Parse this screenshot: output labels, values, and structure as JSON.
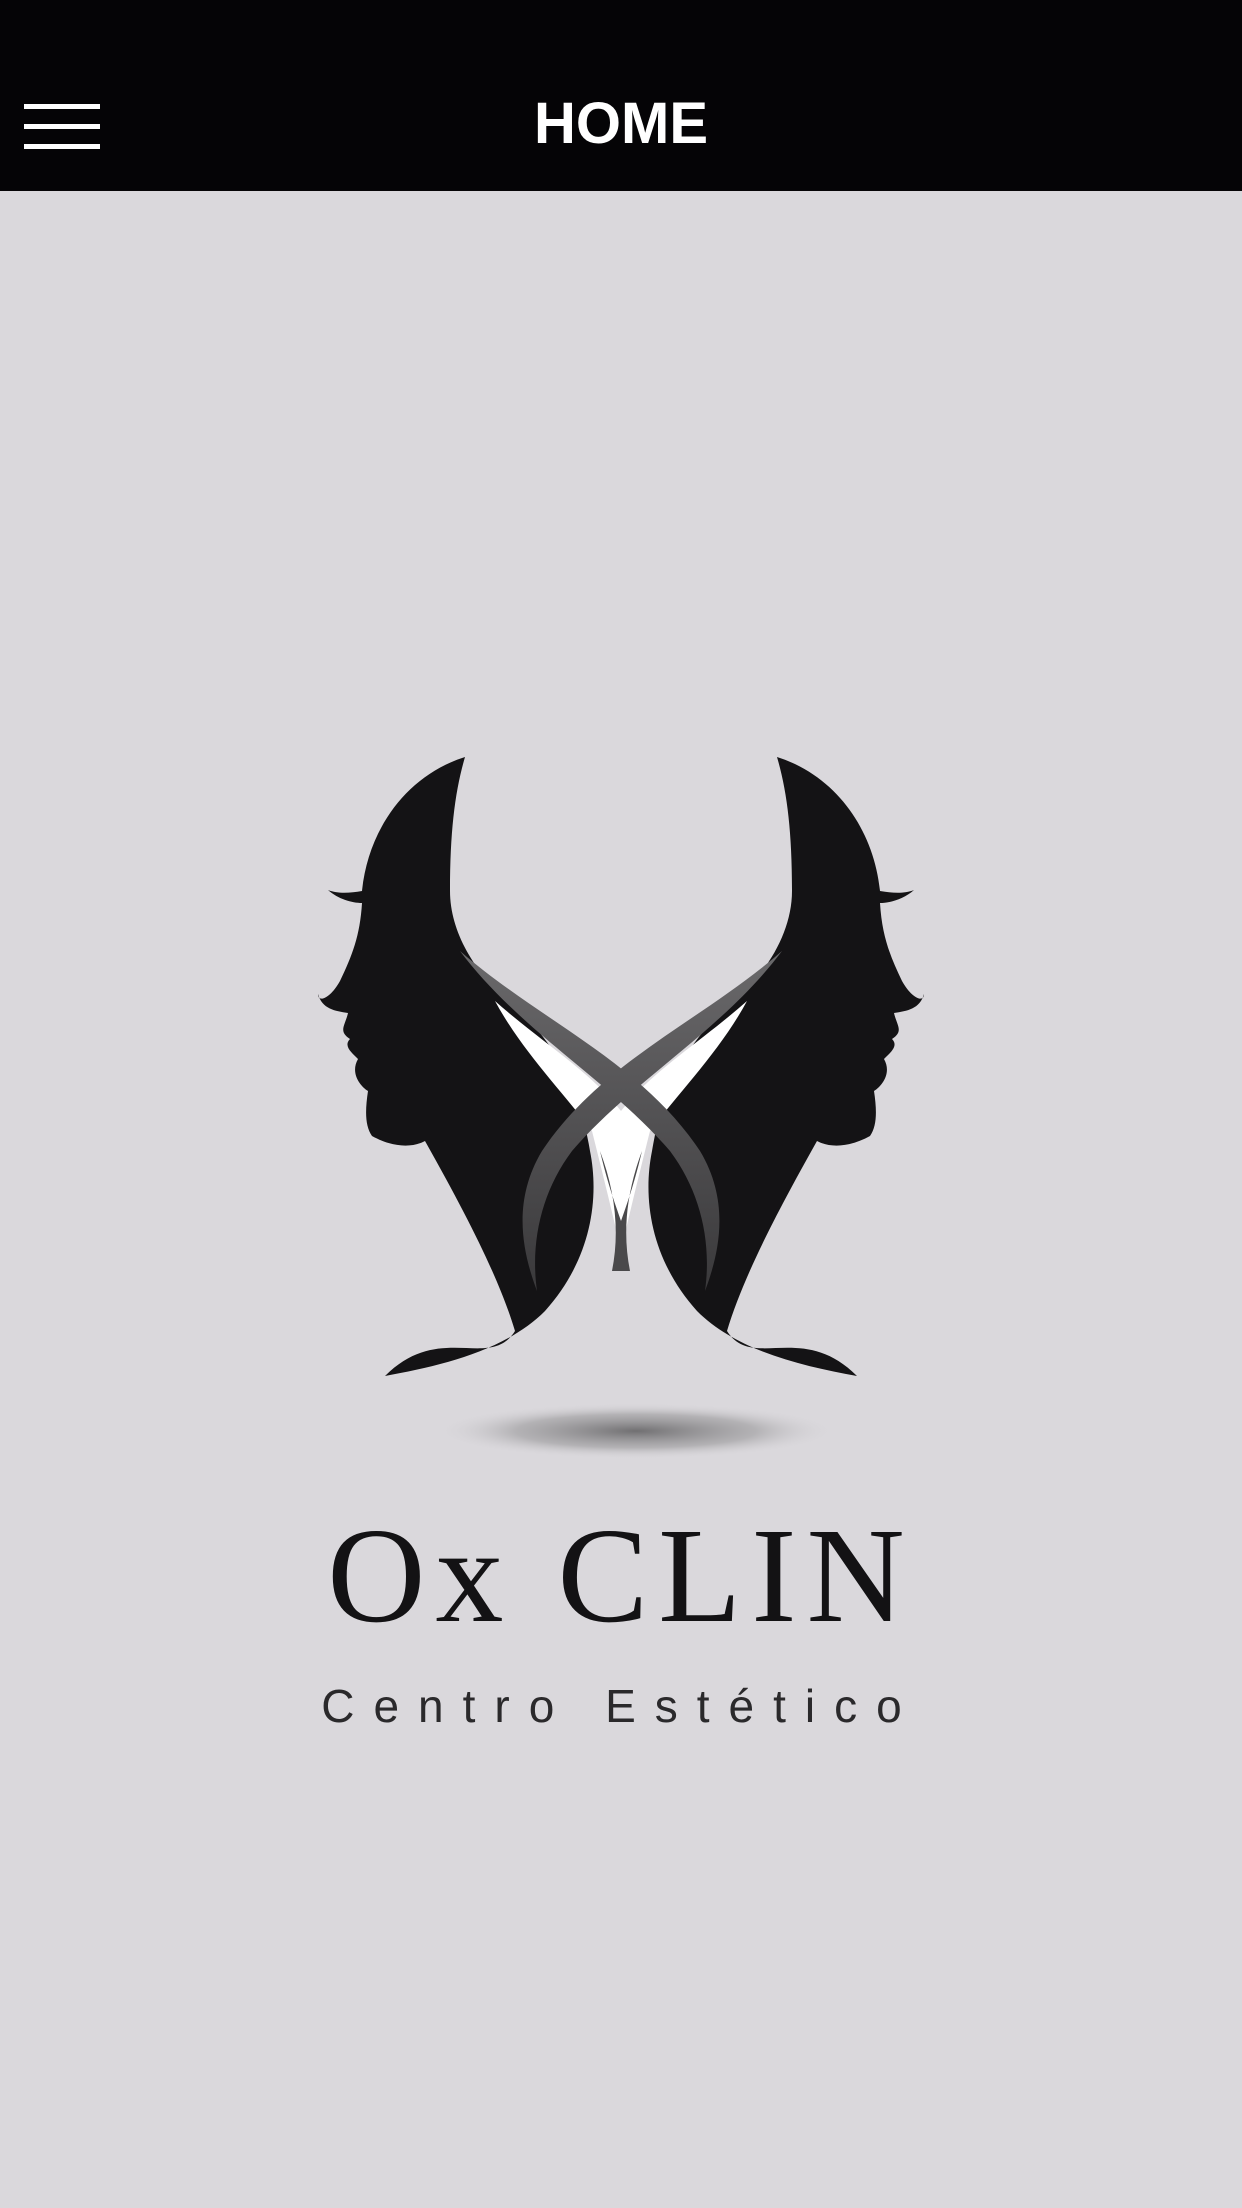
{
  "header": {
    "title": "HOME",
    "menu_icon": "hamburger-menu-icon"
  },
  "logo": {
    "brand_name": "Ox CLIN",
    "tagline": "Centro Estético"
  },
  "colors": {
    "header_background": "#050406",
    "page_background": "#dad8dc",
    "logo_dark": "#131214",
    "title_text": "#ffffff"
  }
}
